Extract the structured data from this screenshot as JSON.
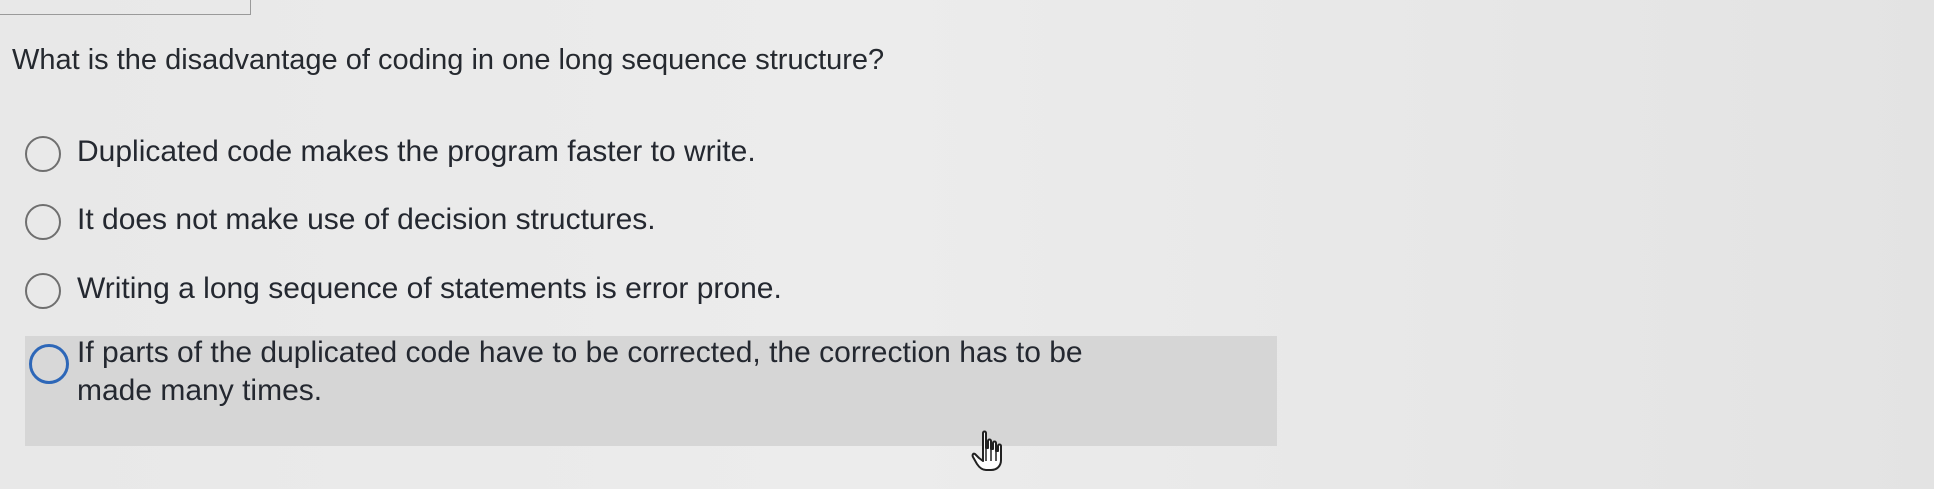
{
  "question": {
    "text": "What is the disadvantage of coding in one long sequence structure?"
  },
  "options": [
    {
      "label": "Duplicated code makes the program faster to write.",
      "selected": false
    },
    {
      "label": "It does not make use of decision structures.",
      "selected": false
    },
    {
      "label": "Writing a long sequence of statements is error prone.",
      "selected": false
    },
    {
      "label": "If parts of the duplicated code have to be corrected, the correction has to be\nmade many times.",
      "selected": true
    }
  ],
  "colors": {
    "background": "#e8e8e8",
    "selected_row": "#d6d6d6",
    "radio_border": "#6f6f6f",
    "radio_focus": "#2d67b8",
    "text": "#25292f"
  },
  "cursor": {
    "icon": "hand-pointer-icon"
  }
}
